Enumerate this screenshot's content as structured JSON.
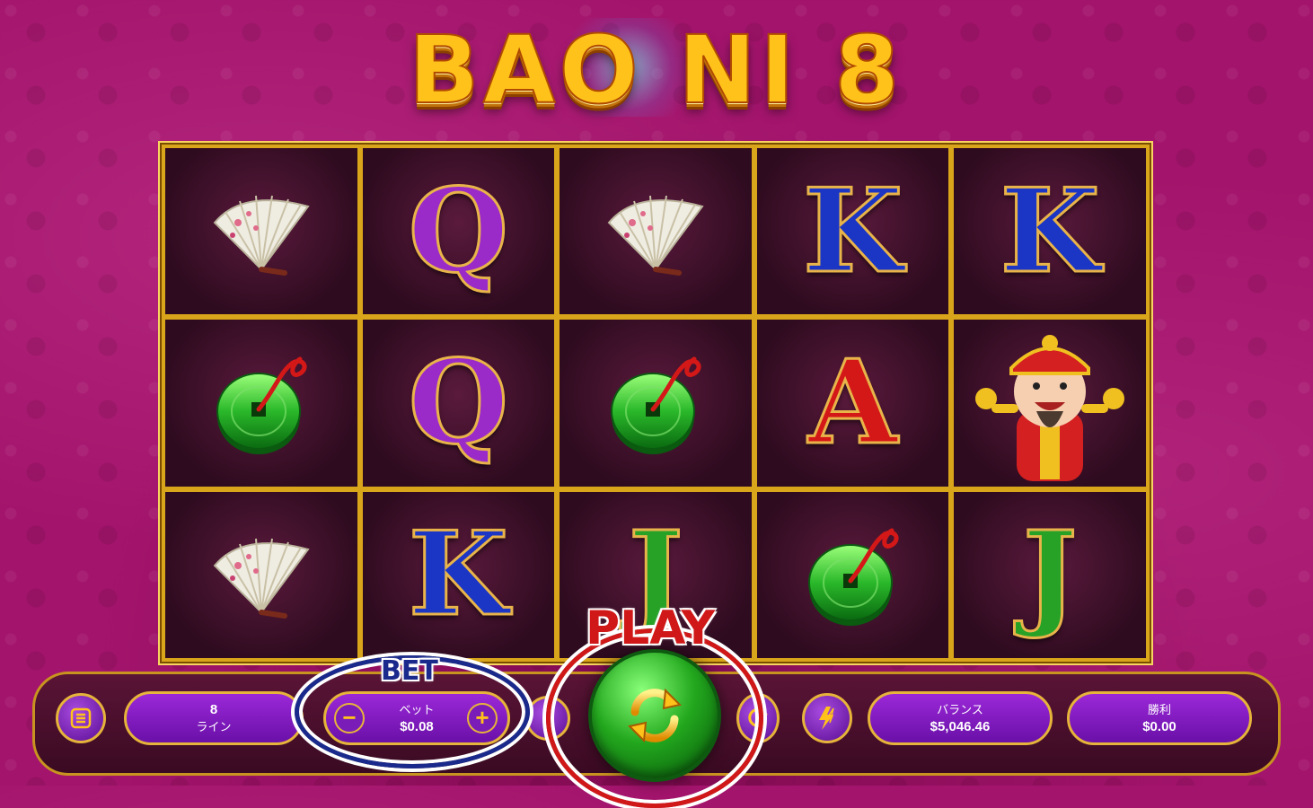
{
  "game": {
    "title": "BAO NI 8"
  },
  "reels": [
    [
      "fan",
      "Q",
      "fan",
      "K",
      "K"
    ],
    [
      "coin",
      "Q",
      "coin",
      "A",
      "fortune-god"
    ],
    [
      "fan",
      "K",
      "J",
      "coin",
      "J"
    ]
  ],
  "controls": {
    "menu_icon": "menu-icon",
    "lines_value": "8",
    "lines_label": "ライン",
    "bet_label": "ベット",
    "bet_value": "$0.08",
    "bet_minus": "−",
    "bet_plus": "+",
    "autoplay_icon": "autoplay-icon",
    "turbo_icon": "lightning-icon",
    "balance_label": "バランス",
    "balance_value": "$5,046.46",
    "win_label": "勝利",
    "win_value": "$0.00"
  },
  "annotations": {
    "bet": "BET",
    "play": "PLAY"
  },
  "colors": {
    "background": "#a3146c",
    "frame": "#d9a51a",
    "pill": "#7a1cb8",
    "annotation_bet": "#1a2a8c",
    "annotation_play": "#d01818"
  }
}
